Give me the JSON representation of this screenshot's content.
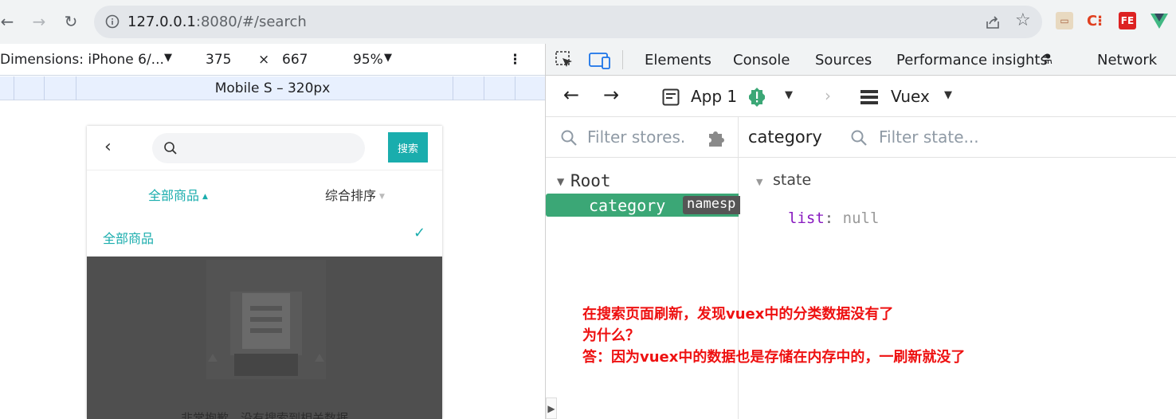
{
  "browser": {
    "url_host": "127.0.0.1",
    "url_rest": ":8080/#/search"
  },
  "device_toolbar": {
    "dimensions": "Dimensions: iPhone 6/...",
    "width": "375",
    "times": "×",
    "height": "667",
    "zoom": "95%",
    "media_label": "Mobile S – 320px"
  },
  "app": {
    "back": "<",
    "search_button": "搜索",
    "filter_all": "全部商品",
    "filter_sort": "综合排序",
    "dropdown_option": "全部商品",
    "empty_text": "非常抱歉，没有搜索到相关数据"
  },
  "devtools": {
    "tabs": [
      "Elements",
      "Console",
      "Sources",
      "Performance insights",
      "Network"
    ],
    "vue_app": "App 1",
    "vue_module": "Vuex",
    "filter_stores_placeholder": "Filter stores.",
    "store_title": "category",
    "filter_state_placeholder": "Filter state...",
    "tree_root": "Root",
    "tree_item": "category",
    "tree_badge": "namesp",
    "state_label": "state",
    "state_key": "list",
    "state_sep": ":",
    "state_value": "null"
  },
  "annotation": {
    "line1": "在搜索页面刷新，发现vuex中的分类数据没有了",
    "line2": "为什么？",
    "line3": "答：因为vuex中的数据也是存储在内存中的，一刷新就没了"
  },
  "colors": {
    "accent_teal": "#1aadad",
    "vue_green": "#3ba776",
    "annotation_red": "#ee1111"
  }
}
